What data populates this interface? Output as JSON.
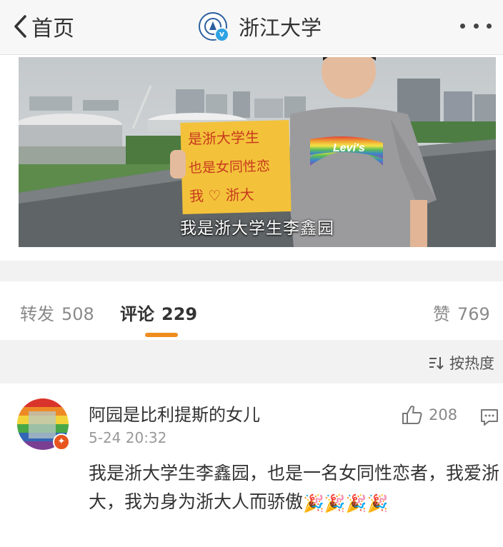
{
  "nav": {
    "back_label": "首页",
    "title": "浙江大学"
  },
  "video": {
    "sign_lines": [
      "是浙大学生",
      "也是女同性恋",
      "我 ♡ 浙大"
    ],
    "shirt_text": "Levi's",
    "caption": "我是浙大学生李鑫园"
  },
  "tabs": {
    "repost_label": "转发",
    "repost_count": "508",
    "comment_label": "评论",
    "comment_count": "229",
    "like_label": "赞",
    "like_count": "769",
    "active": "comment",
    "accent": "#f08c1f"
  },
  "sort": {
    "label": "按热度"
  },
  "comment": {
    "username": "阿园是比利提斯的女儿",
    "time": "5-24 20:32",
    "likes": "208",
    "text": "我是浙大学生李鑫园，也是一名女同性恋者，我爱浙大，我为身为浙大人而骄傲",
    "emoji": "🎉"
  }
}
